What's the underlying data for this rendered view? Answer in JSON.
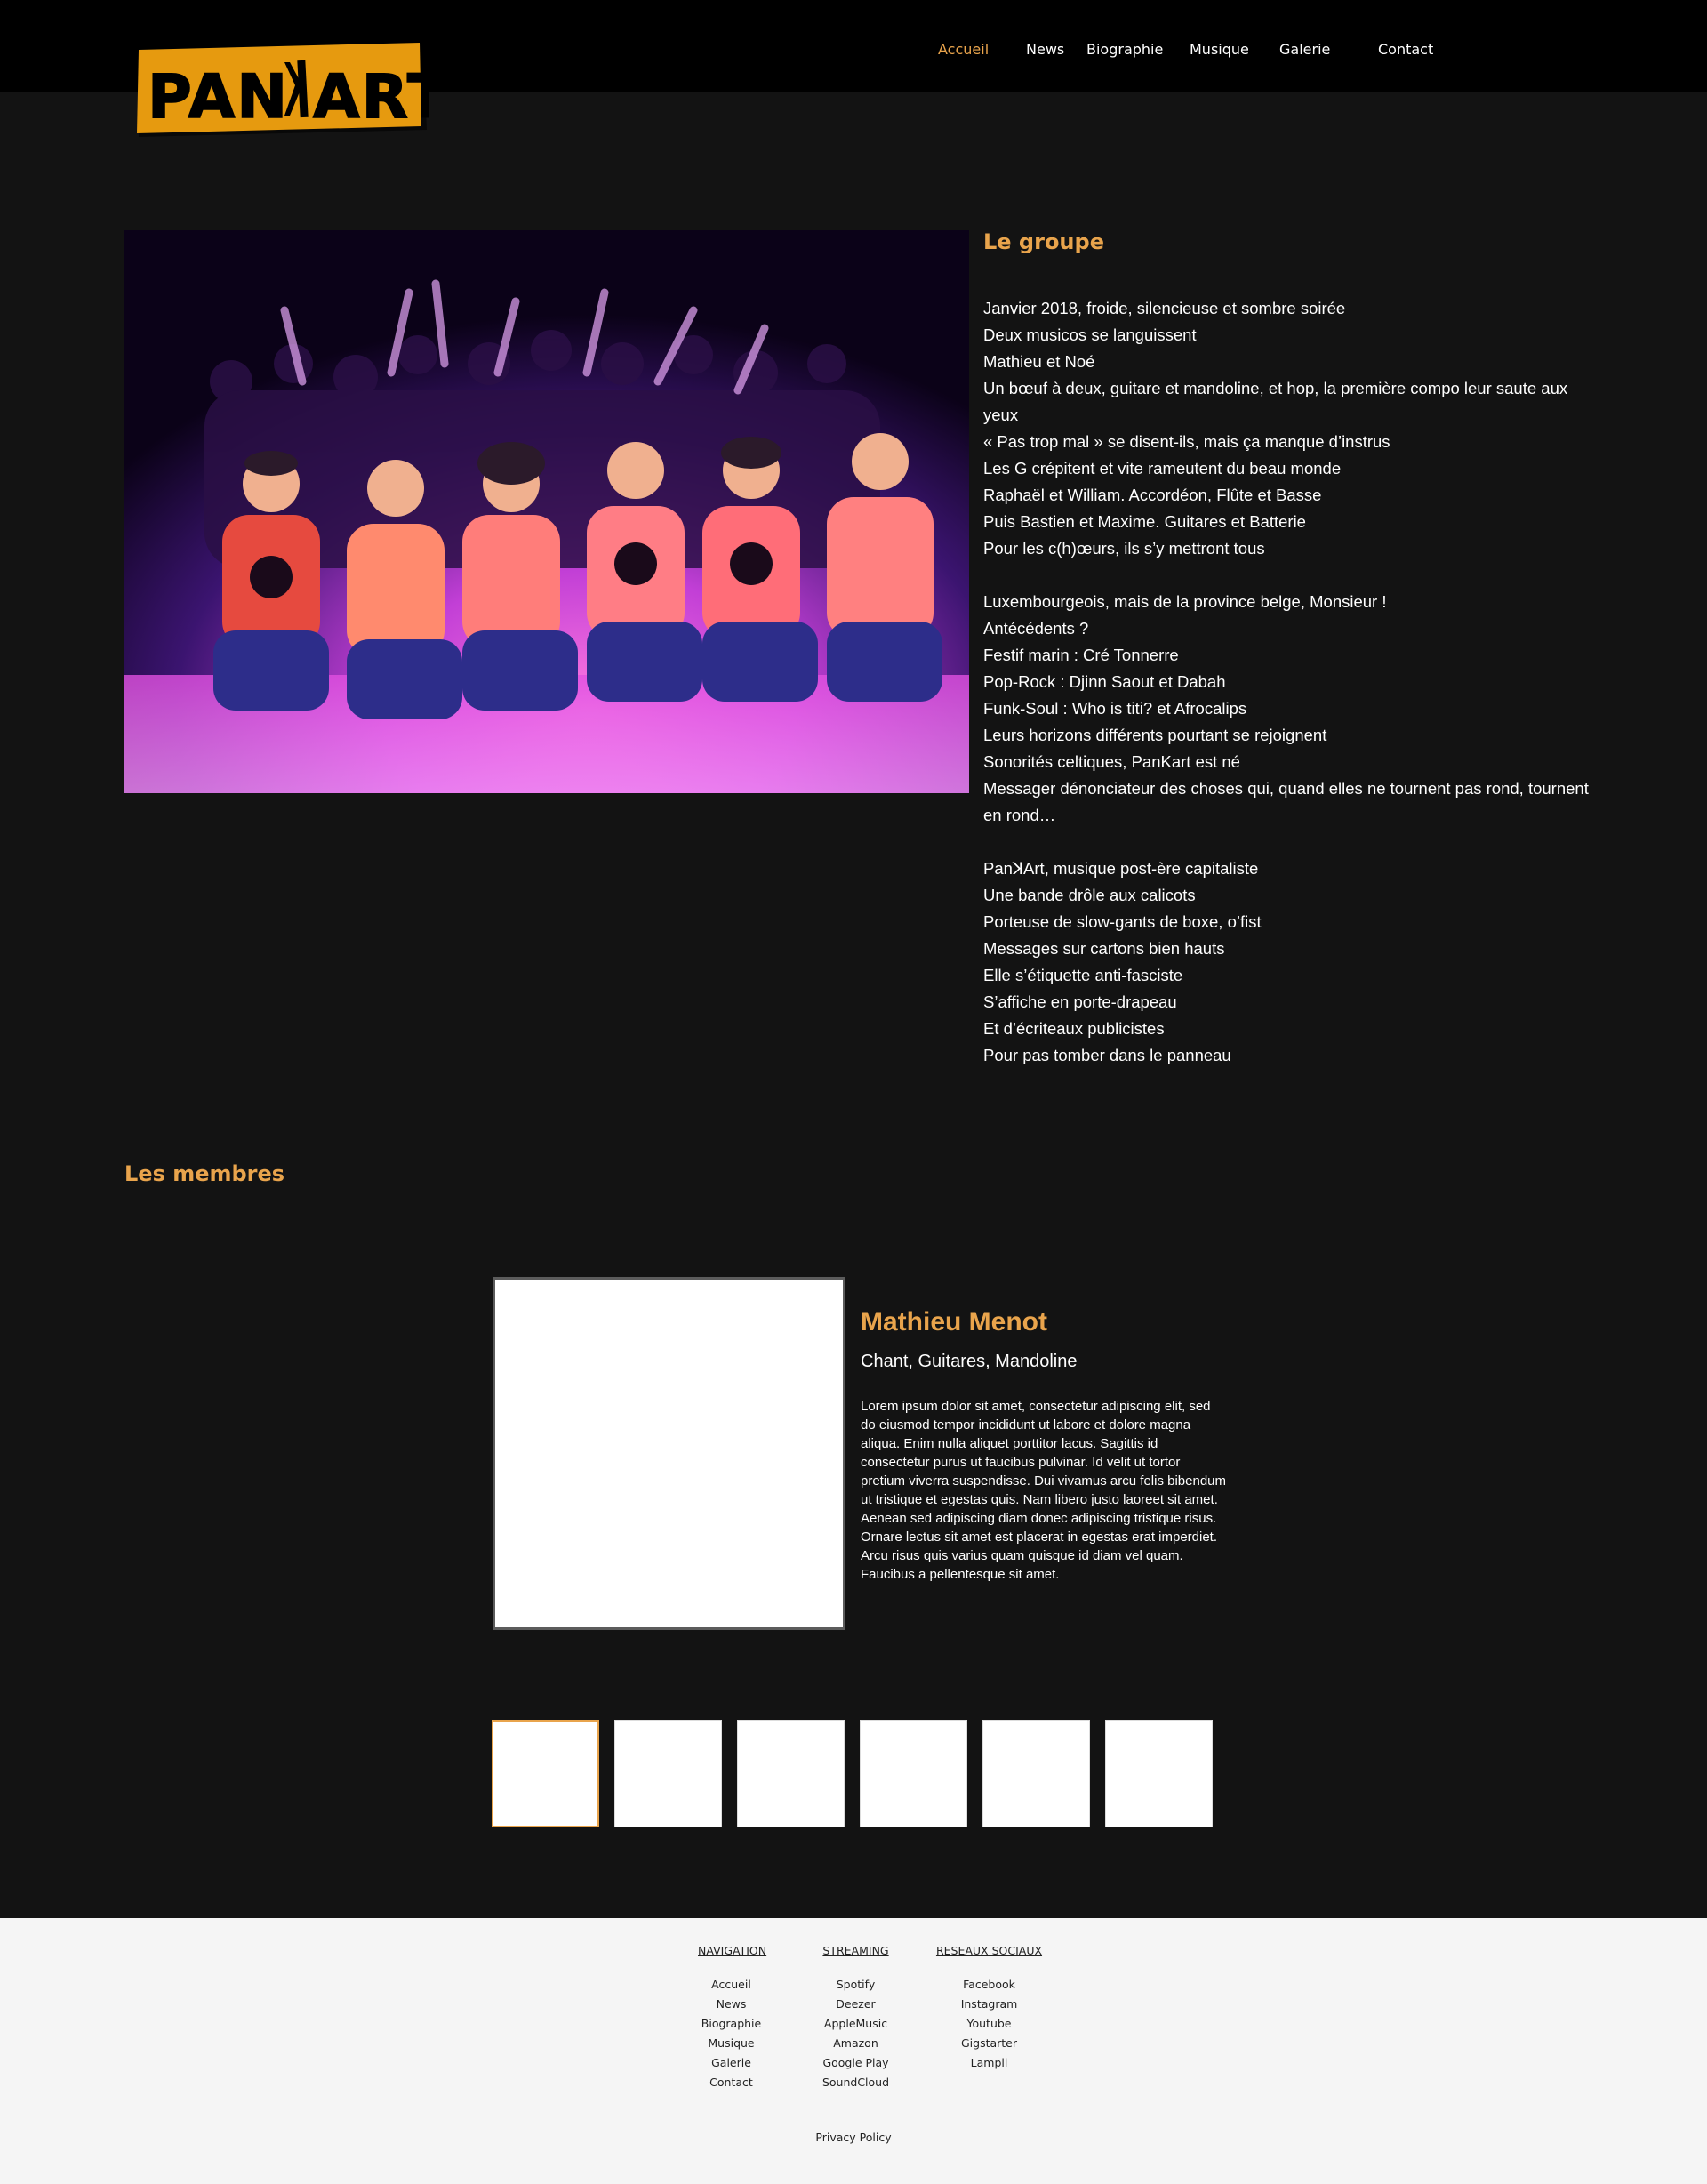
{
  "header": {
    "logo_text": "PANKART",
    "nav": [
      {
        "label": "Accueil",
        "active": true
      },
      {
        "label": "News",
        "active": false
      },
      {
        "label": "Biographie",
        "active": false
      },
      {
        "label": "Musique",
        "active": false
      },
      {
        "label": "Galerie",
        "active": false
      },
      {
        "label": "Contact",
        "active": false
      }
    ]
  },
  "colors": {
    "accent": "#e9a44c",
    "background": "#131313",
    "topbar": "#000000",
    "footer_bg": "#f5f5f5",
    "logo_bg": "#e69a0f"
  },
  "groupe": {
    "title": "Le groupe",
    "lines": [
      "Janvier 2018, froide, silencieuse et sombre soirée",
      "Deux musicos se languissent",
      "Mathieu et Noé",
      "Un bœuf à deux, guitare et mandoline, et hop, la première compo leur saute aux yeux",
      "« Pas trop mal » se disent-ils, mais ça manque d’instrus",
      "Les G crépitent et vite rameutent du beau monde",
      "Raphaël et William. Accordéon, Flûte et Basse",
      "Puis Bastien et Maxime. Guitares et Batterie",
      "Pour les c(h)œurs, ils s’y mettront tous",
      "",
      "Luxembourgeois, mais de la province belge, Monsieur !",
      "Antécédents ?",
      "Festif marin : Cré Tonnerre",
      "Pop-Rock : Djinn Saout et Dabah",
      "Funk-Soul : Who is titi? et Afrocalips",
      "Leurs horizons différents pourtant se rejoignent",
      "Sonorités celtiques, PanKart est né",
      "Messager dénonciateur des choses qui, quand elles ne tournent pas rond, tournent en rond…",
      "",
      "PanꓘArt, musique post-ère capitaliste",
      "Une bande drôle aux calicots",
      "Porteuse de slow-gants de boxe, o’fist",
      "Messages sur cartons bien hauts",
      "Elle s’étiquette anti-fasciste",
      "S’affiche en porte-drapeau",
      "Et d’écriteaux publicistes",
      "Pour pas tomber dans le panneau"
    ]
  },
  "membres": {
    "title": "Les membres",
    "member": {
      "name": "Mathieu Menot",
      "role": "Chant, Guitares, Mandoline",
      "bio": "Lorem ipsum dolor sit amet, consectetur adipiscing elit, sed do eiusmod tempor incididunt ut labore et dolore magna aliqua. Enim nulla aliquet porttitor lacus. Sagittis id consectetur purus ut faucibus pulvinar. Id velit ut tortor pretium viverra suspendisse. Dui vivamus arcu felis bibendum ut tristique et egestas quis. Nam libero justo laoreet sit amet. Aenean sed adipiscing diam donec adipiscing tristique risus. Ornare lectus sit amet est placerat in egestas erat imperdiet. Arcu risus quis varius quam quisque id diam vel quam. Faucibus a pellentesque sit amet."
    },
    "thumbnail_count": 6,
    "active_thumbnail": 1
  },
  "footer": {
    "columns": [
      {
        "title": "NAVIGATION",
        "links": [
          "Accueil",
          "News",
          "Biographie",
          "Musique",
          "Galerie",
          "Contact"
        ]
      },
      {
        "title": "STREAMING",
        "links": [
          "Spotify",
          "Deezer",
          "AppleMusic",
          "Amazon",
          "Google Play",
          "SoundCloud"
        ]
      },
      {
        "title": "RESEAUX SOCIAUX",
        "links": [
          "Facebook",
          "Instagram",
          "Youtube",
          "Gigstarter",
          "Lampli"
        ]
      }
    ],
    "privacy": "Privacy Policy"
  }
}
